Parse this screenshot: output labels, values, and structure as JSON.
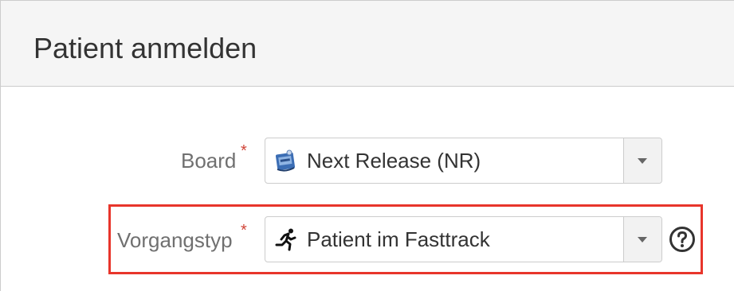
{
  "dialog": {
    "title": "Patient anmelden"
  },
  "fields": {
    "board": {
      "label": "Board",
      "required_marker": "*",
      "selected_value": "Next Release (NR)",
      "icon": "project-avatar-icon"
    },
    "issue_type": {
      "label": "Vorgangstyp",
      "required_marker": "*",
      "selected_value": "Patient im Fasttrack",
      "icon": "running-person-icon",
      "help_icon": "question-circle-icon"
    }
  },
  "colors": {
    "required": "#d04437",
    "highlight": "#e8352b",
    "header_background": "#f5f5f5",
    "label": "#707070"
  }
}
